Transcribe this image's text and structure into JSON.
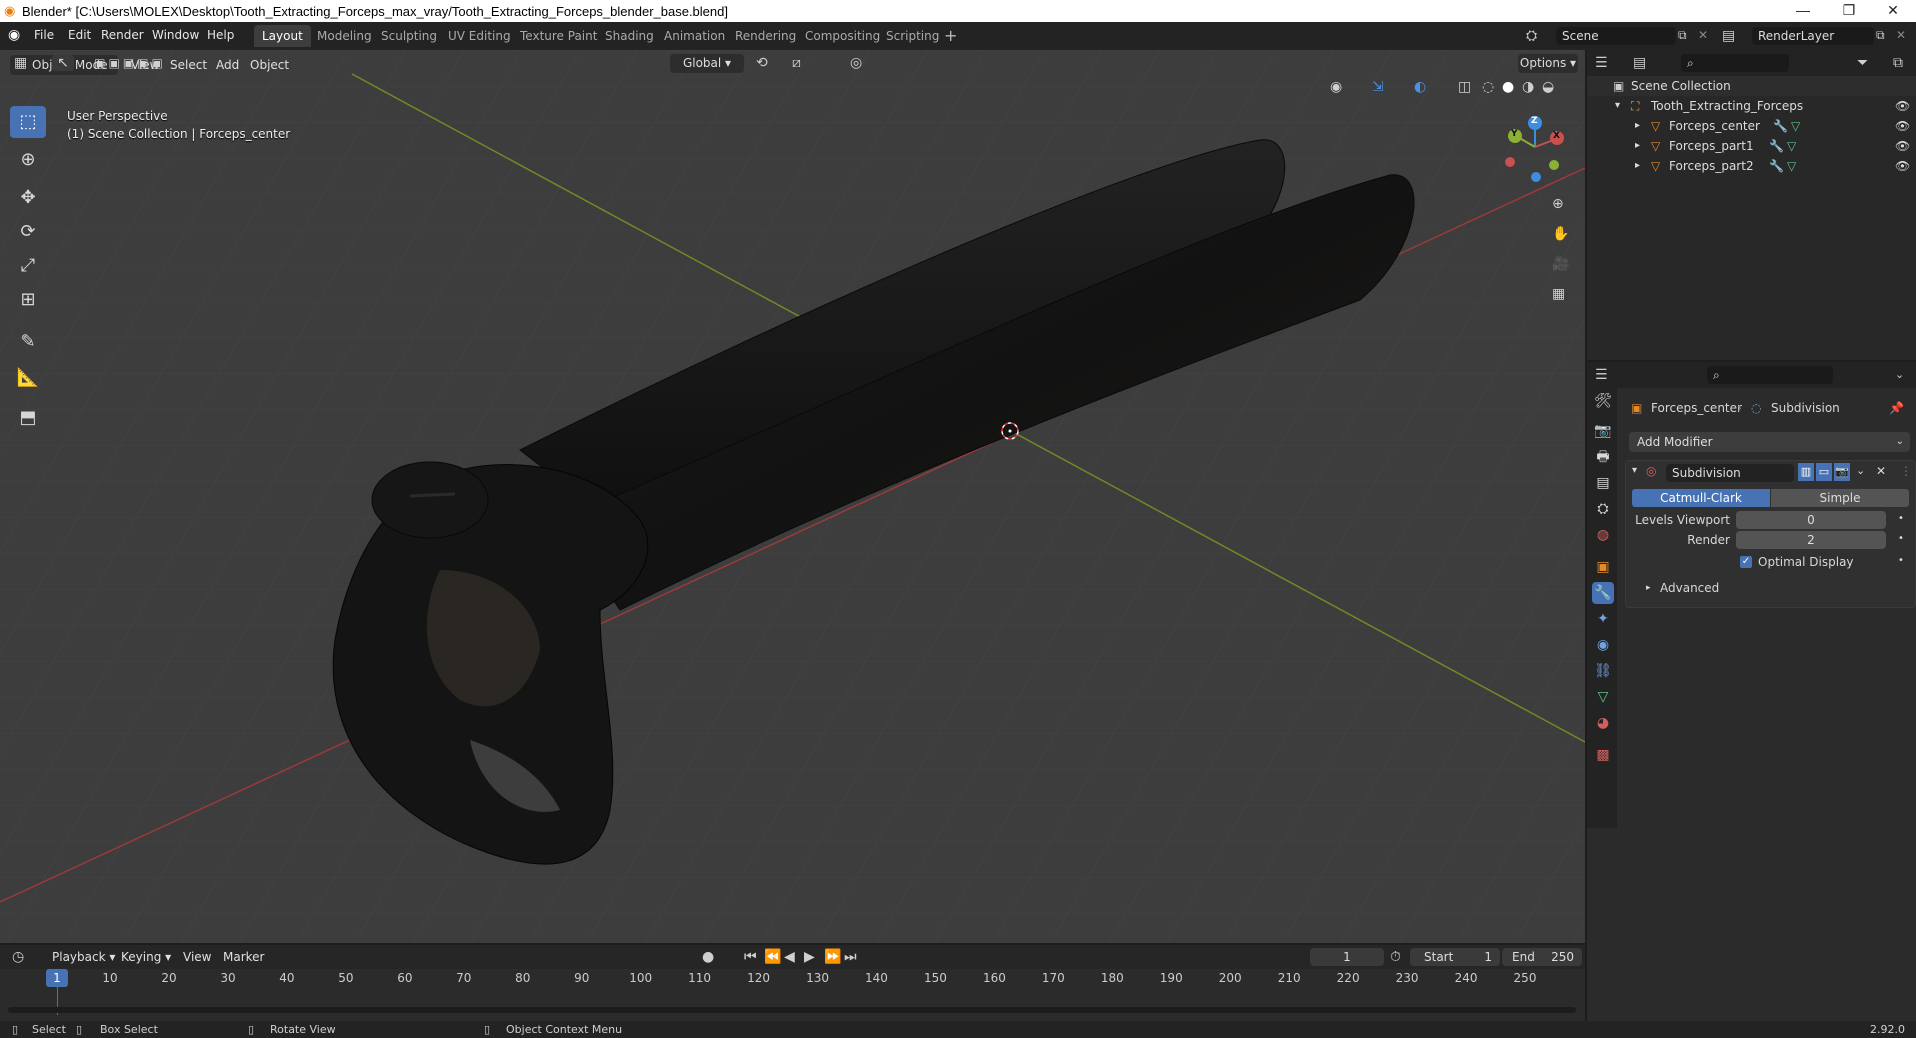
{
  "window": {
    "title": "Blender* [C:\\Users\\MOLEX\\Desktop\\Tooth_Extracting_Forceps_max_vray/Tooth_Extracting_Forceps_blender_base.blend]",
    "controls": [
      "minimize-icon",
      "restore-icon",
      "close-icon"
    ]
  },
  "menu": [
    "File",
    "Edit",
    "Render",
    "Window",
    "Help"
  ],
  "workspaces": [
    "Layout",
    "Modeling",
    "Sculpting",
    "UV Editing",
    "Texture Paint",
    "Shading",
    "Animation",
    "Rendering",
    "Compositing",
    "Scripting"
  ],
  "active_workspace": "Layout",
  "scene": {
    "name": "Scene",
    "view_layer": "RenderLayer"
  },
  "viewport_header": {
    "mode": "Object Mode",
    "menus": [
      "View",
      "Select",
      "Add",
      "Object"
    ],
    "orientation": "Global",
    "options_label": "Options"
  },
  "viewport": {
    "overlay_line1": "User Perspective",
    "overlay_line2": "(1) Scene Collection | Forceps_center",
    "tools": [
      "select-box-icon",
      "cursor-icon",
      "move-icon",
      "rotate-icon",
      "scale-icon",
      "transform-icon",
      "annotate-icon",
      "measure-icon",
      "add-cube-icon"
    ],
    "gizmo_axes": [
      "Y",
      "Z",
      "X"
    ],
    "nav_icons": [
      "zoom-icon",
      "pan-hand-icon",
      "camera-icon",
      "grid-icon"
    ]
  },
  "outliner": {
    "root": "Scene Collection",
    "collection": "Tooth_Extracting_Forceps",
    "objects": [
      "Forceps_center",
      "Forceps_part1",
      "Forceps_part2"
    ]
  },
  "properties": {
    "object": "Forceps_center",
    "modifier_context": "Subdivision",
    "add_modifier_label": "Add Modifier",
    "modifier": {
      "name": "Subdivision",
      "modes": [
        "Catmull-Clark",
        "Simple"
      ],
      "active_mode": "Catmull-Clark",
      "levels_viewport_label": "Levels Viewport",
      "levels_viewport": "0",
      "render_label": "Render",
      "render": "2",
      "optimal_display_label": "Optimal Display",
      "optimal_display": true,
      "advanced_label": "Advanced"
    }
  },
  "timeline": {
    "menus": [
      "Playback",
      "Keying",
      "View",
      "Marker"
    ],
    "current_frame": "1",
    "start_label": "Start",
    "start": "1",
    "end_label": "End",
    "end": "250",
    "ticks": [
      "1",
      "10",
      "20",
      "30",
      "40",
      "50",
      "60",
      "70",
      "80",
      "90",
      "100",
      "110",
      "120",
      "130",
      "140",
      "150",
      "160",
      "170",
      "180",
      "190",
      "200",
      "210",
      "220",
      "230",
      "240",
      "250"
    ]
  },
  "status_bar": {
    "select": "Select",
    "box_select": "Box Select",
    "rotate_view": "Rotate View",
    "context_menu": "Object Context Menu",
    "version": "2.92.0"
  },
  "colors": {
    "accent": "#4772b3",
    "x_axis": "#c8504f",
    "y_axis": "#8cb036",
    "z_axis": "#3d8ee0",
    "object_orange": "#e08a2c"
  }
}
